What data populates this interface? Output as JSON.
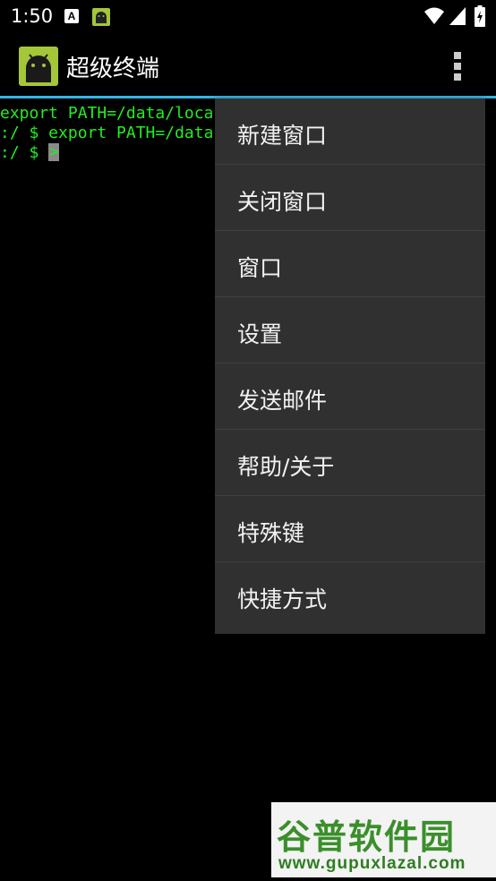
{
  "status_bar": {
    "time": "1:50",
    "notification_a_letter": "A",
    "icons": [
      "a-notification-icon",
      "android-app-icon",
      "wifi-icon",
      "signal-icon",
      "battery-icon"
    ]
  },
  "action_bar": {
    "title": "超级终端",
    "accent_color": "#33b5e5",
    "logo_color": "#a4c639"
  },
  "terminal": {
    "lines": [
      "export PATH=/data/loca",
      ":/ $ export PATH=/data",
      ":/ $ "
    ],
    "cursor_char": ">",
    "text_color": "#22ee22"
  },
  "menu": {
    "items": [
      {
        "label": "新建窗口"
      },
      {
        "label": "关闭窗口"
      },
      {
        "label": "窗口"
      },
      {
        "label": "设置"
      },
      {
        "label": "发送邮件"
      },
      {
        "label": "帮助/关于"
      },
      {
        "label": "特殊键"
      },
      {
        "label": "快捷方式"
      }
    ]
  },
  "watermark": {
    "title": "谷普软件园",
    "url": "www.gupuxlazal.com"
  }
}
